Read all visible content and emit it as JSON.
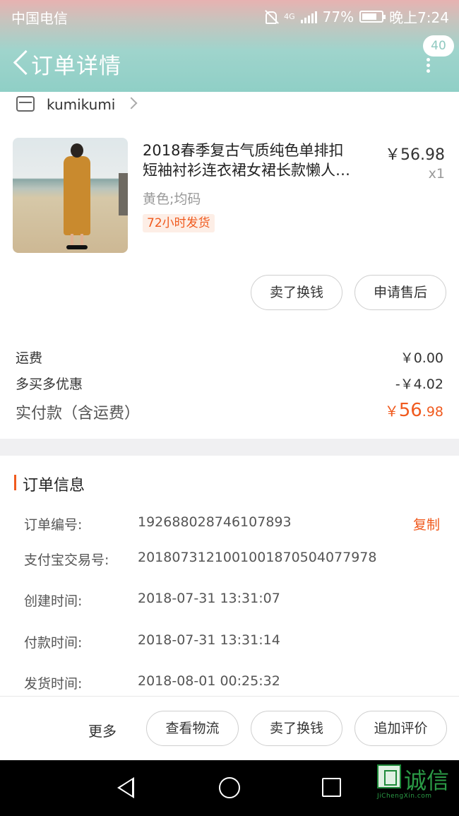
{
  "status_bar": {
    "carrier": "中国电信",
    "signal_label": "4G",
    "battery": "77%",
    "time": "晚上7:24"
  },
  "nav": {
    "title": "订单详情",
    "message_count": "40"
  },
  "shop": {
    "name": "kumikumi"
  },
  "product": {
    "title_line1": "2018春季复古气质纯色单排扣",
    "title_line2": "短袖衬衫连衣裙女裙长款懒人…",
    "price": "￥56.98",
    "quantity": "x1",
    "sku": "黄色;均码",
    "ship_tag": "72小时发货",
    "actions": {
      "sell_label": "卖了换钱",
      "after_sale_label": "申请售后"
    }
  },
  "costs": {
    "shipping_label": "运费",
    "shipping_value": "￥0.00",
    "discount_label": "多买多优惠",
    "discount_value": "-￥4.02",
    "total_label": "实付款（含运费）",
    "total_currency": "￥",
    "total_int": "56",
    "total_dec": ".98"
  },
  "order_info": {
    "title": "订单信息",
    "copy_label": "复制",
    "rows": [
      {
        "key": "订单编号:",
        "value": "192688028746107893"
      },
      {
        "key": "支付宝交易号:",
        "value": "2018073121001001870504077978"
      },
      {
        "key": "创建时间:",
        "value": "2018-07-31 13:31:07"
      },
      {
        "key": "付款时间:",
        "value": "2018-07-31 13:31:14"
      },
      {
        "key": "发货时间:",
        "value": "2018-08-01 00:25:32"
      }
    ]
  },
  "action_bar": {
    "more_label": "更多",
    "logistics_label": "查看物流",
    "sell_label": "卖了换钱",
    "review_label": "追加评价"
  },
  "watermark": {
    "brand": "诚信",
    "domain": "JiChengXin.com"
  }
}
